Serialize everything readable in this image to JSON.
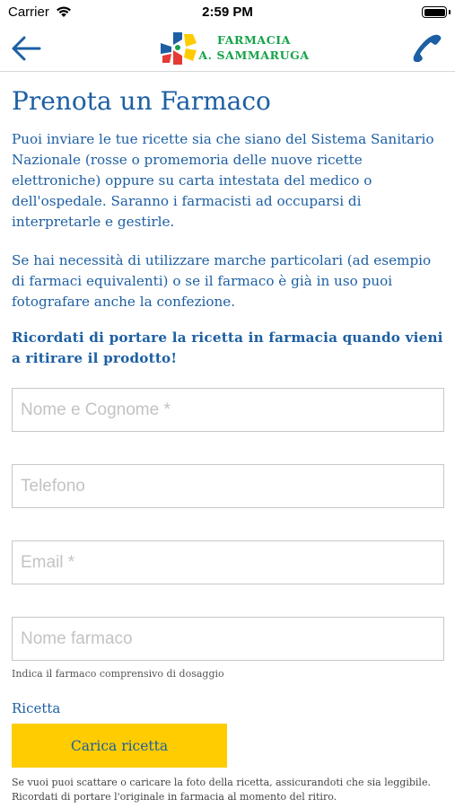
{
  "status_bar": {
    "carrier": "Carrier",
    "time": "2:59 PM"
  },
  "header": {
    "logo_line1": "FARMACIA",
    "logo_line2": "A. SAMMARUGA"
  },
  "page": {
    "title": "Prenota un Farmaco",
    "paragraph1": "Puoi inviare le tue ricette sia che siano del Sistema Sanitario Nazionale (rosse o promemoria delle nuove ricette elettroniche) oppure su carta intestata del medico o dell'ospedale. Saranno i farmacisti ad occuparsi di interpretarle e gestirle.",
    "paragraph2": "Se hai necessità di utilizzare marche particolari (ad esempio di farmaci equivalenti) o se il farmaco è già in uso puoi fotografare anche la confezione.",
    "reminder": "Ricordati di portare la ricetta in farmacia quando vieni a ritirare il prodotto!"
  },
  "form": {
    "name_placeholder": "Nome e Cognome *",
    "phone_placeholder": "Telefono",
    "email_placeholder": "Email *",
    "drug_placeholder": "Nome farmaco",
    "drug_hint": "Indica il farmaco comprensivo di dosaggio",
    "prescription_label": "Ricetta",
    "upload_label": "Carica ricetta",
    "upload_note": "Se vuoi puoi scattare o caricare la foto della ricetta, assicurandoti che sia leggibile. Ricordati di portare l'originale in farmacia al momento del ritiro."
  },
  "colors": {
    "accent": "#1d5fa3",
    "button": "#fecc00",
    "logo_text": "#17a34a"
  },
  "icons": [
    "back-arrow-icon",
    "phone-icon",
    "wifi-icon",
    "battery-icon",
    "pharmacy-logo-icon"
  ]
}
